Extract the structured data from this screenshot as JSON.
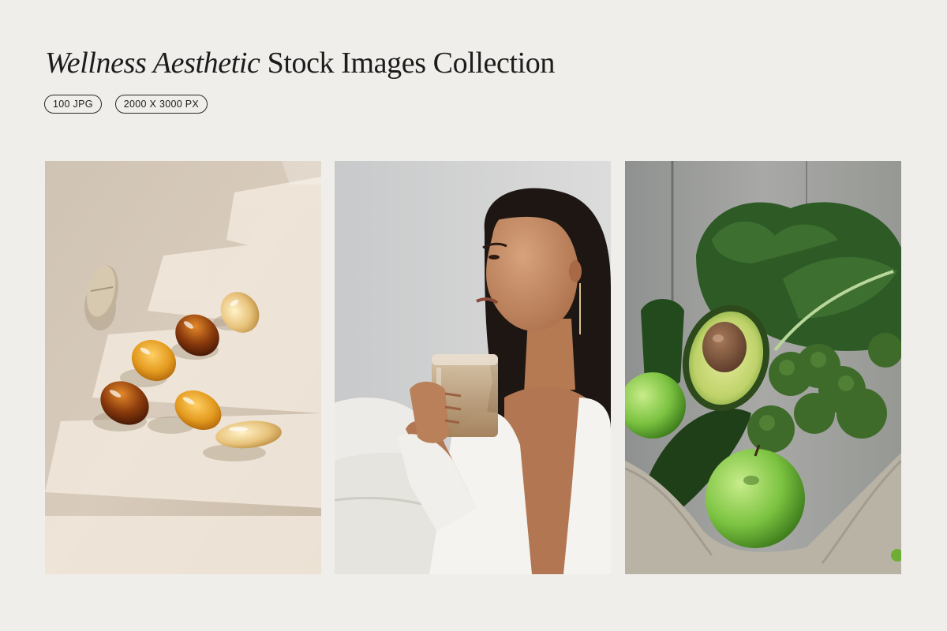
{
  "header": {
    "title_italic": "Wellness Aesthetic",
    "title_rest": "Stock Images Collection"
  },
  "badges": [
    {
      "label": "100 JPG"
    },
    {
      "label": "2000 X 3000 PX"
    }
  ],
  "colors": {
    "background": "#f0eeeb",
    "text": "#1c1c1c"
  }
}
